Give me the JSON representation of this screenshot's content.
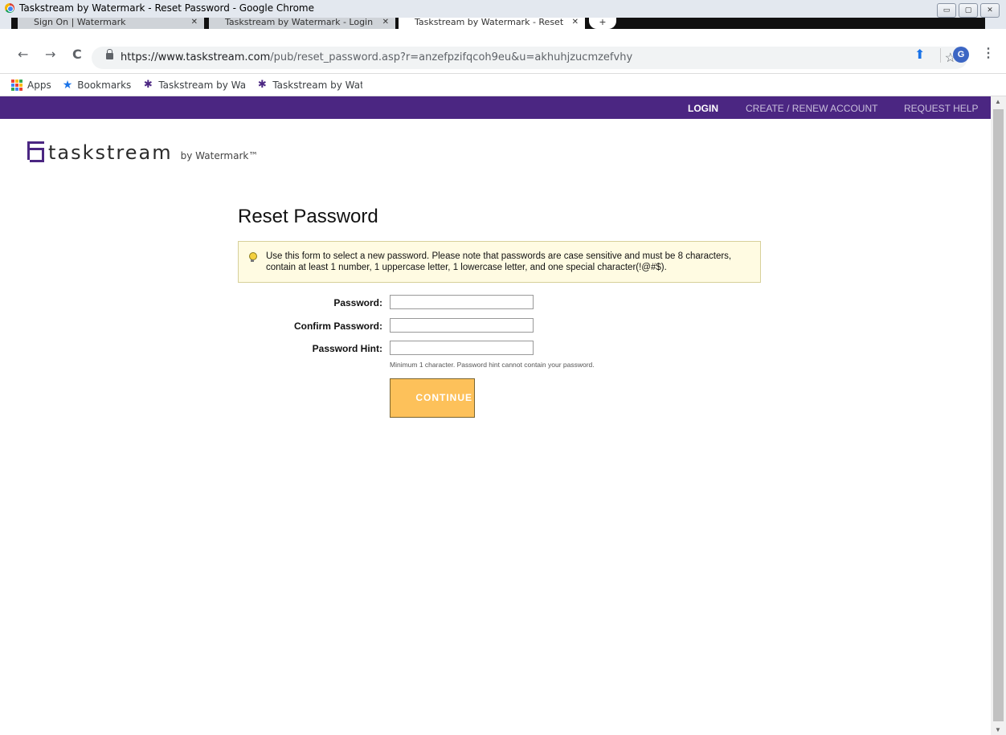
{
  "window": {
    "title": "Taskstream by Watermark - Reset Password - Google Chrome",
    "controls": {
      "minimize": "▭",
      "maximize": "▢",
      "close": "✕"
    }
  },
  "tabs": [
    {
      "label": "Sign On | Watermark",
      "close": "✕"
    },
    {
      "label": "Taskstream by Watermark - Login",
      "close": "✕"
    },
    {
      "label": "Taskstream by Watermark - Reset",
      "close": "✕"
    }
  ],
  "new_tab": "+",
  "toolbar": {
    "back": "←",
    "forward": "→",
    "reload": "C",
    "url_host": "https://www.taskstream.com",
    "url_path": "/pub/reset_password.asp?r=anzefpzifqcoh9eu&u=akhuhjzucmzefvhy",
    "star": "☆",
    "ext": "⬆",
    "profile_initial": "G",
    "menu": "⋮"
  },
  "bookmarks": [
    {
      "icon": "apps-icon",
      "label": "Apps"
    },
    {
      "icon": "star-icon",
      "label": "Bookmarks"
    },
    {
      "icon": "taskstream-favicon",
      "label": "Taskstream by Watermark"
    },
    {
      "icon": "taskstream-favicon",
      "label": "Taskstream by Watermark"
    }
  ],
  "topnav": {
    "login": "LOGIN",
    "create": "CREATE / RENEW ACCOUNT",
    "help": "REQUEST HELP"
  },
  "logo": {
    "text": "taskstream",
    "by": "by Watermark™"
  },
  "page": {
    "heading": "Reset Password",
    "info_line1": "Use this form to select a new password. Please note that passwords are case sensitive and must be 8 characters,",
    "info_line2": "contain at least 1 number, 1 uppercase letter, 1 lowercase letter, and one special character(!@#$).",
    "fields": {
      "password": {
        "label": "Password:",
        "value": ""
      },
      "confirm": {
        "label": "Confirm Password:",
        "value": ""
      },
      "hint": {
        "label": "Password Hint:",
        "value": ""
      }
    },
    "hint_note": "Minimum 1 character. Password hint cannot contain your password.",
    "continue": "CONTINUE"
  },
  "colors": {
    "brand_purple": "#4b2682",
    "button_yellow": "#fdc15a",
    "info_bg": "#fffbe2"
  }
}
